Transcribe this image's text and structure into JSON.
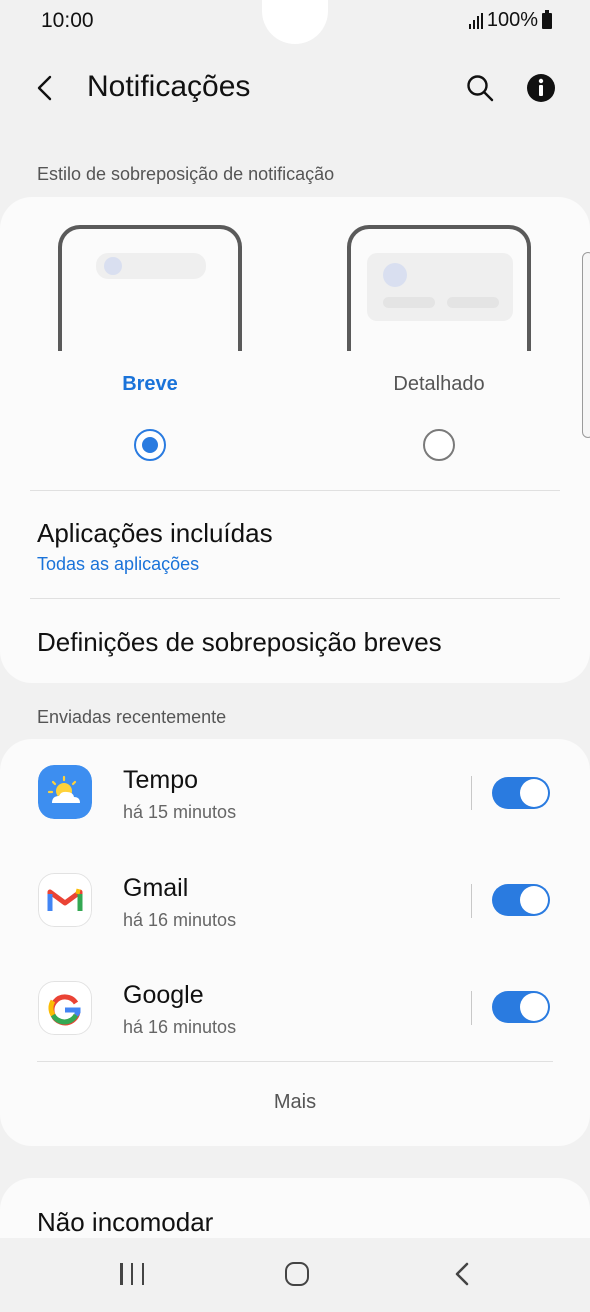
{
  "status_bar": {
    "time": "10:00",
    "battery": "100%"
  },
  "header": {
    "title": "Notificações"
  },
  "overlay_style": {
    "section_label": "Estilo de sobreposição de notificação",
    "options": [
      {
        "label": "Breve",
        "selected": true
      },
      {
        "label": "Detalhado",
        "selected": false
      }
    ]
  },
  "included_apps": {
    "title": "Aplicações incluídas",
    "subtitle": "Todas as aplicações"
  },
  "brief_settings": {
    "title": "Definições de sobreposição breves"
  },
  "recent": {
    "section_label": "Enviadas recentemente",
    "apps": [
      {
        "name": "Tempo",
        "time": "há 15 minutos",
        "icon": "weather-icon",
        "enabled": true
      },
      {
        "name": "Gmail",
        "time": "há 16 minutos",
        "icon": "gmail-icon",
        "enabled": true
      },
      {
        "name": "Google",
        "time": "há 16 minutos",
        "icon": "google-icon",
        "enabled": true
      }
    ],
    "more_label": "Mais"
  },
  "do_not_disturb": {
    "title": "Não incomodar"
  },
  "colors": {
    "accent": "#2a7be0",
    "background": "#f1f1f1",
    "card": "#fbfbfb"
  }
}
